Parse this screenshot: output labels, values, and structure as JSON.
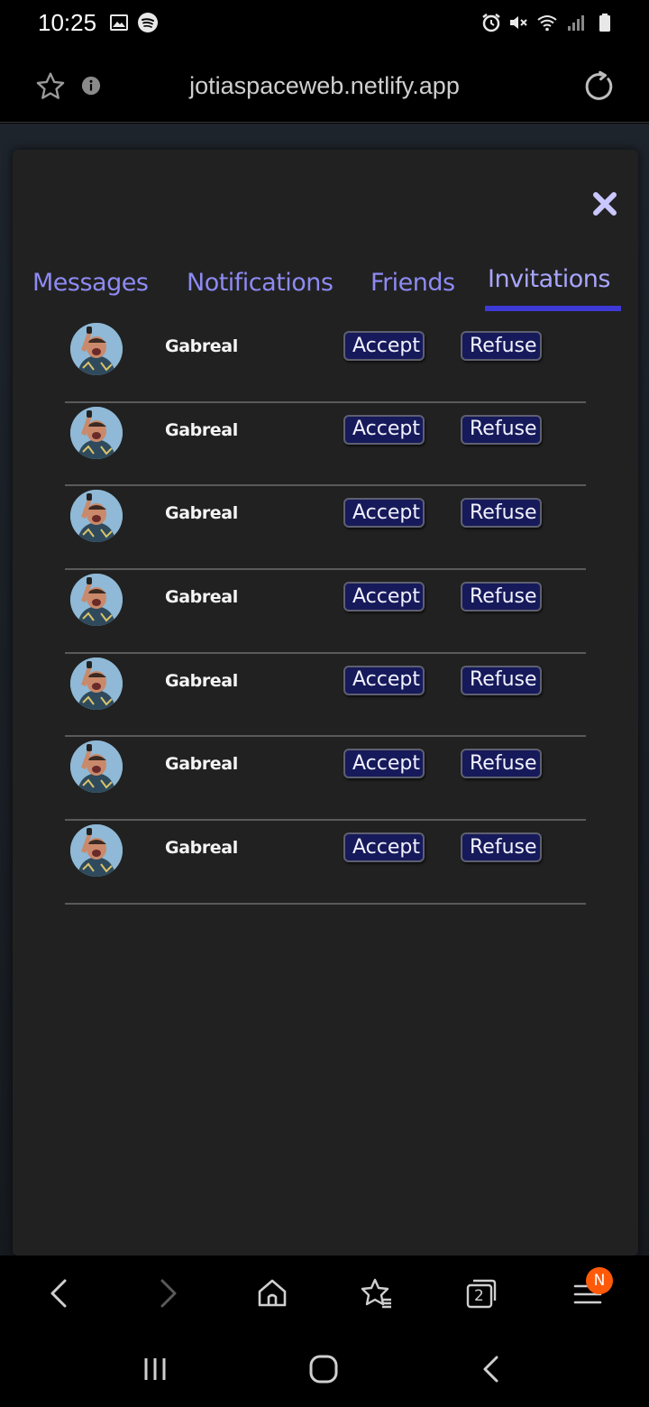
{
  "status_bar": {
    "time": "10:25",
    "left_icons": [
      "image-icon",
      "spotify-icon"
    ],
    "right_icons": [
      "alarm-icon",
      "mute-icon",
      "wifi-icon",
      "signal-icon",
      "battery-icon"
    ]
  },
  "browser": {
    "url": "jotiaspaceweb.netlify.app",
    "icons": [
      "star-icon",
      "info-icon",
      "reload-icon"
    ]
  },
  "modal": {
    "close_icon": "close-icon",
    "tabs": [
      {
        "label": "Messages",
        "active": false
      },
      {
        "label": "Notifications",
        "active": false
      },
      {
        "label": "Friends",
        "active": false
      },
      {
        "label": "Invitations",
        "active": true
      }
    ],
    "invitations": [
      {
        "name": "Gabreal",
        "accept": "Accept",
        "refuse": "Refuse"
      },
      {
        "name": "Gabreal",
        "accept": "Accept",
        "refuse": "Refuse"
      },
      {
        "name": "Gabreal",
        "accept": "Accept",
        "refuse": "Refuse"
      },
      {
        "name": "Gabreal",
        "accept": "Accept",
        "refuse": "Refuse"
      },
      {
        "name": "Gabreal",
        "accept": "Accept",
        "refuse": "Refuse"
      },
      {
        "name": "Gabreal",
        "accept": "Accept",
        "refuse": "Refuse"
      },
      {
        "name": "Gabreal",
        "accept": "Accept",
        "refuse": "Refuse"
      }
    ]
  },
  "bottom_nav": {
    "tab_count": "2",
    "menu_badge": "N",
    "icons": [
      "back-icon",
      "forward-icon",
      "home-icon",
      "bookmarks-icon",
      "tabs-icon",
      "menu-icon"
    ]
  },
  "system_nav": {
    "icons": [
      "recents-icon",
      "home-button-icon",
      "back-icon"
    ]
  },
  "colors": {
    "tab_text": "#8e8af3",
    "tab_active_underline": "#3d3ad6",
    "button_bg": "#161a5a",
    "modal_bg": "#212121",
    "badge": "#ff5a0a"
  }
}
